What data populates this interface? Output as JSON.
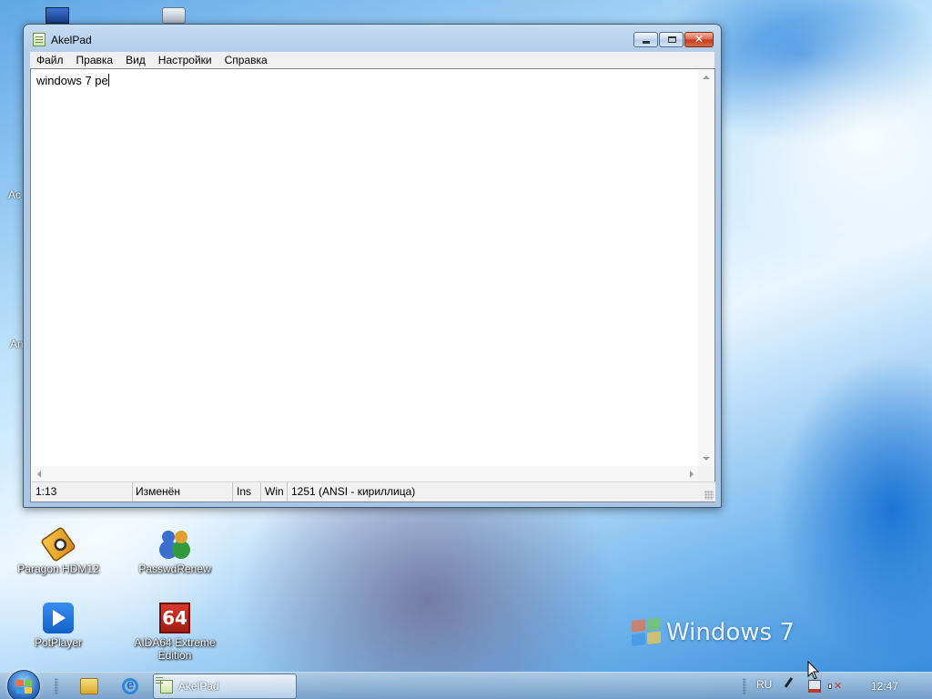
{
  "window": {
    "title": "AkelPad",
    "menu": [
      "Файл",
      "Правка",
      "Вид",
      "Настройки",
      "Справка"
    ],
    "editor_text": "windows 7 pe",
    "status": {
      "position": "1:13",
      "modified": "Изменён",
      "insert_mode": "Ins",
      "newline": "Win",
      "codepage": "1251  (ANSI - кириллица)"
    }
  },
  "desktop": {
    "icons": [
      {
        "label": "Paragon HDM12",
        "icon": "paragon-hdm-icon"
      },
      {
        "label": "PasswdRenew",
        "icon": "users-icon"
      },
      {
        "label": "PotPlayer",
        "icon": "potplayer-icon"
      },
      {
        "label": "AIDA64 Extreme Edition",
        "icon": "aida64-icon",
        "icon_text": "64"
      }
    ],
    "partial_labels": [
      "Ac",
      "An"
    ],
    "watermark": "Windows 7"
  },
  "taskbar": {
    "task_label": "AkelPad",
    "language": "RU",
    "clock": "12:47"
  },
  "colors": {
    "window_frame": "#b2cde9",
    "close_button": "#c53a1c",
    "taskbar": "#87acd0"
  }
}
